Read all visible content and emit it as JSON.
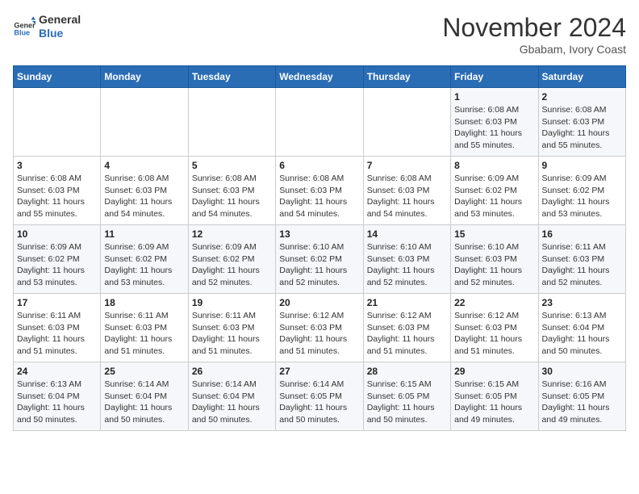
{
  "header": {
    "logo_line1": "General",
    "logo_line2": "Blue",
    "month": "November 2024",
    "location": "Gbabam, Ivory Coast"
  },
  "days_of_week": [
    "Sunday",
    "Monday",
    "Tuesday",
    "Wednesday",
    "Thursday",
    "Friday",
    "Saturday"
  ],
  "weeks": [
    [
      {
        "day": "",
        "info": ""
      },
      {
        "day": "",
        "info": ""
      },
      {
        "day": "",
        "info": ""
      },
      {
        "day": "",
        "info": ""
      },
      {
        "day": "",
        "info": ""
      },
      {
        "day": "1",
        "info": "Sunrise: 6:08 AM\nSunset: 6:03 PM\nDaylight: 11 hours and 55 minutes."
      },
      {
        "day": "2",
        "info": "Sunrise: 6:08 AM\nSunset: 6:03 PM\nDaylight: 11 hours and 55 minutes."
      }
    ],
    [
      {
        "day": "3",
        "info": "Sunrise: 6:08 AM\nSunset: 6:03 PM\nDaylight: 11 hours and 55 minutes."
      },
      {
        "day": "4",
        "info": "Sunrise: 6:08 AM\nSunset: 6:03 PM\nDaylight: 11 hours and 54 minutes."
      },
      {
        "day": "5",
        "info": "Sunrise: 6:08 AM\nSunset: 6:03 PM\nDaylight: 11 hours and 54 minutes."
      },
      {
        "day": "6",
        "info": "Sunrise: 6:08 AM\nSunset: 6:03 PM\nDaylight: 11 hours and 54 minutes."
      },
      {
        "day": "7",
        "info": "Sunrise: 6:08 AM\nSunset: 6:03 PM\nDaylight: 11 hours and 54 minutes."
      },
      {
        "day": "8",
        "info": "Sunrise: 6:09 AM\nSunset: 6:02 PM\nDaylight: 11 hours and 53 minutes."
      },
      {
        "day": "9",
        "info": "Sunrise: 6:09 AM\nSunset: 6:02 PM\nDaylight: 11 hours and 53 minutes."
      }
    ],
    [
      {
        "day": "10",
        "info": "Sunrise: 6:09 AM\nSunset: 6:02 PM\nDaylight: 11 hours and 53 minutes."
      },
      {
        "day": "11",
        "info": "Sunrise: 6:09 AM\nSunset: 6:02 PM\nDaylight: 11 hours and 53 minutes."
      },
      {
        "day": "12",
        "info": "Sunrise: 6:09 AM\nSunset: 6:02 PM\nDaylight: 11 hours and 52 minutes."
      },
      {
        "day": "13",
        "info": "Sunrise: 6:10 AM\nSunset: 6:02 PM\nDaylight: 11 hours and 52 minutes."
      },
      {
        "day": "14",
        "info": "Sunrise: 6:10 AM\nSunset: 6:03 PM\nDaylight: 11 hours and 52 minutes."
      },
      {
        "day": "15",
        "info": "Sunrise: 6:10 AM\nSunset: 6:03 PM\nDaylight: 11 hours and 52 minutes."
      },
      {
        "day": "16",
        "info": "Sunrise: 6:11 AM\nSunset: 6:03 PM\nDaylight: 11 hours and 52 minutes."
      }
    ],
    [
      {
        "day": "17",
        "info": "Sunrise: 6:11 AM\nSunset: 6:03 PM\nDaylight: 11 hours and 51 minutes."
      },
      {
        "day": "18",
        "info": "Sunrise: 6:11 AM\nSunset: 6:03 PM\nDaylight: 11 hours and 51 minutes."
      },
      {
        "day": "19",
        "info": "Sunrise: 6:11 AM\nSunset: 6:03 PM\nDaylight: 11 hours and 51 minutes."
      },
      {
        "day": "20",
        "info": "Sunrise: 6:12 AM\nSunset: 6:03 PM\nDaylight: 11 hours and 51 minutes."
      },
      {
        "day": "21",
        "info": "Sunrise: 6:12 AM\nSunset: 6:03 PM\nDaylight: 11 hours and 51 minutes."
      },
      {
        "day": "22",
        "info": "Sunrise: 6:12 AM\nSunset: 6:03 PM\nDaylight: 11 hours and 51 minutes."
      },
      {
        "day": "23",
        "info": "Sunrise: 6:13 AM\nSunset: 6:04 PM\nDaylight: 11 hours and 50 minutes."
      }
    ],
    [
      {
        "day": "24",
        "info": "Sunrise: 6:13 AM\nSunset: 6:04 PM\nDaylight: 11 hours and 50 minutes."
      },
      {
        "day": "25",
        "info": "Sunrise: 6:14 AM\nSunset: 6:04 PM\nDaylight: 11 hours and 50 minutes."
      },
      {
        "day": "26",
        "info": "Sunrise: 6:14 AM\nSunset: 6:04 PM\nDaylight: 11 hours and 50 minutes."
      },
      {
        "day": "27",
        "info": "Sunrise: 6:14 AM\nSunset: 6:05 PM\nDaylight: 11 hours and 50 minutes."
      },
      {
        "day": "28",
        "info": "Sunrise: 6:15 AM\nSunset: 6:05 PM\nDaylight: 11 hours and 50 minutes."
      },
      {
        "day": "29",
        "info": "Sunrise: 6:15 AM\nSunset: 6:05 PM\nDaylight: 11 hours and 49 minutes."
      },
      {
        "day": "30",
        "info": "Sunrise: 6:16 AM\nSunset: 6:05 PM\nDaylight: 11 hours and 49 minutes."
      }
    ]
  ]
}
